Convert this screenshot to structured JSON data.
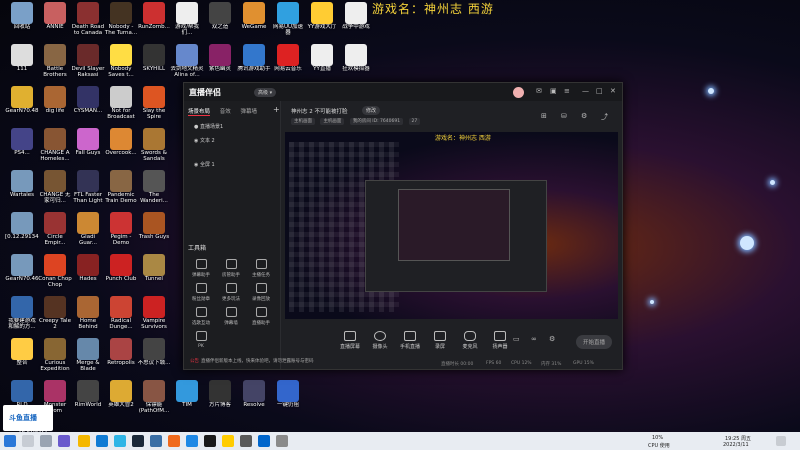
{
  "desktop": {
    "game_title": "游戏名：神州志 西游",
    "icons": [
      {
        "label": "回收站",
        "color": "#7aa0c8"
      },
      {
        "label": "ANNIE",
        "color": "#c86060"
      },
      {
        "label": "Death Road to Canada",
        "color": "#8a3030"
      },
      {
        "label": "Nobody - The Turna...",
        "color": "#443322"
      },
      {
        "label": "RunZomb...",
        "color": "#cc3030"
      },
      {
        "label": "游戏/帮我们...",
        "color": "#eeeeee"
      },
      {
        "label": "双之造",
        "color": "#444444"
      },
      {
        "label": "WeGame",
        "color": "#e09030"
      },
      {
        "label": "网易UU加速器",
        "color": "#30a0e0"
      },
      {
        "label": "YY游戏大厅",
        "color": "#ffcc33"
      },
      {
        "label": "战争中游戏",
        "color": "#eeeeee"
      },
      {
        "label": "111",
        "color": "#dddddd"
      },
      {
        "label": "Battle Brothers",
        "color": "#886644"
      },
      {
        "label": "Devil Slayer Raksasi",
        "color": "#6a2a2a"
      },
      {
        "label": "Nobody Saves t...",
        "color": "#ffdd44"
      },
      {
        "label": "SKYHILL",
        "color": "#333333"
      },
      {
        "label": "去剑地文精灵 Alina of...",
        "color": "#6688cc"
      },
      {
        "label": "紫色幽灵",
        "color": "#882266"
      },
      {
        "label": "腾讯游戏助手",
        "color": "#3377cc"
      },
      {
        "label": "网易云音乐",
        "color": "#dd2222"
      },
      {
        "label": "YY直播",
        "color": "#eeeeee"
      },
      {
        "label": "狂欢模拟器",
        "color": "#eeeeee"
      },
      {
        "label": "GearN70.48",
        "color": "#e0b030"
      },
      {
        "label": "dig life",
        "color": "#aa6633"
      },
      {
        "label": "CYSMAN...",
        "color": "#333366"
      },
      {
        "label": "Not for Broadcast",
        "color": "#cccccc"
      },
      {
        "label": "Slay the Spire",
        "color": "#dd5522"
      },
      {
        "label": "PS4...",
        "color": "#444488"
      },
      {
        "label": "CHANGE A Homeles...",
        "color": "#885533"
      },
      {
        "label": "Fall Guys",
        "color": "#cc66cc"
      },
      {
        "label": "Overcook...",
        "color": "#dd8833"
      },
      {
        "label": "Swords & Sandals",
        "color": "#aa7733"
      },
      {
        "label": "Wartales",
        "color": "#7799bb"
      },
      {
        "label": "CHANGE 无家可归...",
        "color": "#775533"
      },
      {
        "label": "FTL Faster Than Light",
        "color": "#333355"
      },
      {
        "label": "Pandemic Train Demo",
        "color": "#886644"
      },
      {
        "label": "The Wanderi...",
        "color": "#555555"
      },
      {
        "label": "[0.12.29134]",
        "color": "#7799bb"
      },
      {
        "label": "Circle Empir...",
        "color": "#993333"
      },
      {
        "label": "Gladi Guar...",
        "color": "#cc8833"
      },
      {
        "label": "Pegim - Demo",
        "color": "#cc3333"
      },
      {
        "label": "Trash Guys",
        "color": "#aa5522"
      },
      {
        "label": "GearN70.46",
        "color": "#7799bb"
      },
      {
        "label": "Conan Chop Chop",
        "color": "#dd4422"
      },
      {
        "label": "Hades",
        "color": "#882222"
      },
      {
        "label": "Punch Club",
        "color": "#cc2222"
      },
      {
        "label": "Tunnel",
        "color": "#aa8844"
      },
      {
        "label": "我要建游戏 和解的方...",
        "color": "#3366aa"
      },
      {
        "label": "Creepy Tale 2",
        "color": "#553322"
      },
      {
        "label": "Home Behind",
        "color": "#aa6633"
      },
      {
        "label": "Radical Dunge...",
        "color": "#cc4433"
      },
      {
        "label": "Vampire Survivors",
        "color": "#cc2222"
      },
      {
        "label": "整合",
        "color": "#ffcc44"
      },
      {
        "label": "Curious Expedition",
        "color": "#886633"
      },
      {
        "label": "Merge & Blade",
        "color": "#6688aa"
      },
      {
        "label": "Retropolis",
        "color": "#aa4444"
      },
      {
        "label": "不思议下城...",
        "color": "#444444"
      },
      {
        "label": "RLD",
        "color": "#3366aa"
      },
      {
        "label": "Monster Prom",
        "color": "#aa3366"
      },
      {
        "label": "RimWorld",
        "color": "#444444"
      },
      {
        "label": "英雄大冒2",
        "color": "#ddaa33"
      },
      {
        "label": "保镖能 (PathOfM...",
        "color": "#885544"
      },
      {
        "label": "TIM",
        "color": "#3399dd"
      },
      {
        "label": "方片博客",
        "color": "#333333"
      },
      {
        "label": "Resolve",
        "color": "#444466"
      },
      {
        "label": "一键仍阻",
        "color": "#3366cc"
      }
    ]
  },
  "app": {
    "logo": "直播伴侣",
    "logo_badge": "高级 ▾",
    "left_tabs": [
      "场景布局",
      "音效",
      "弹幕墙"
    ],
    "scenes": [
      "直播场景1",
      "文本 2",
      "全屏 1"
    ],
    "tools_title": "工具箱",
    "tools": [
      "弹幕助手",
      "房管助手",
      "主播任务",
      "粉丝勋章",
      "更多玩法",
      "录像回放",
      "选歌互动",
      "弹幕墙",
      "直播助手",
      "PK"
    ],
    "room_title": "神州志 2 不可能被打脸",
    "edit_label": "修改",
    "chips": [
      "主机画面",
      "主机画面",
      "我的房间 ID: 7640691",
      "27"
    ],
    "preview_title": "游戏名：神州志 西游",
    "bottom_buttons": [
      "直播屏幕",
      "摄像头",
      "手机直播",
      "录屏",
      "麦克风",
      "扬声器"
    ],
    "live_button": "开始直播",
    "stats": [
      "直播时长 00:00",
      "FPS 60",
      "CPU 12%",
      "内存 31%",
      "GPU 15%"
    ],
    "notice_tag": "公告",
    "notice_text": "直播伴侣新版本上线，快来体验吧，请勿泄露账号与密码"
  },
  "watermark": {
    "brand": "斗鱼直播",
    "room_id": "7640691"
  },
  "taskbar": {
    "cpu": "10%",
    "cpu_label": "CPU 使用",
    "time": "19:25 周五",
    "date": "2022/3/11"
  }
}
